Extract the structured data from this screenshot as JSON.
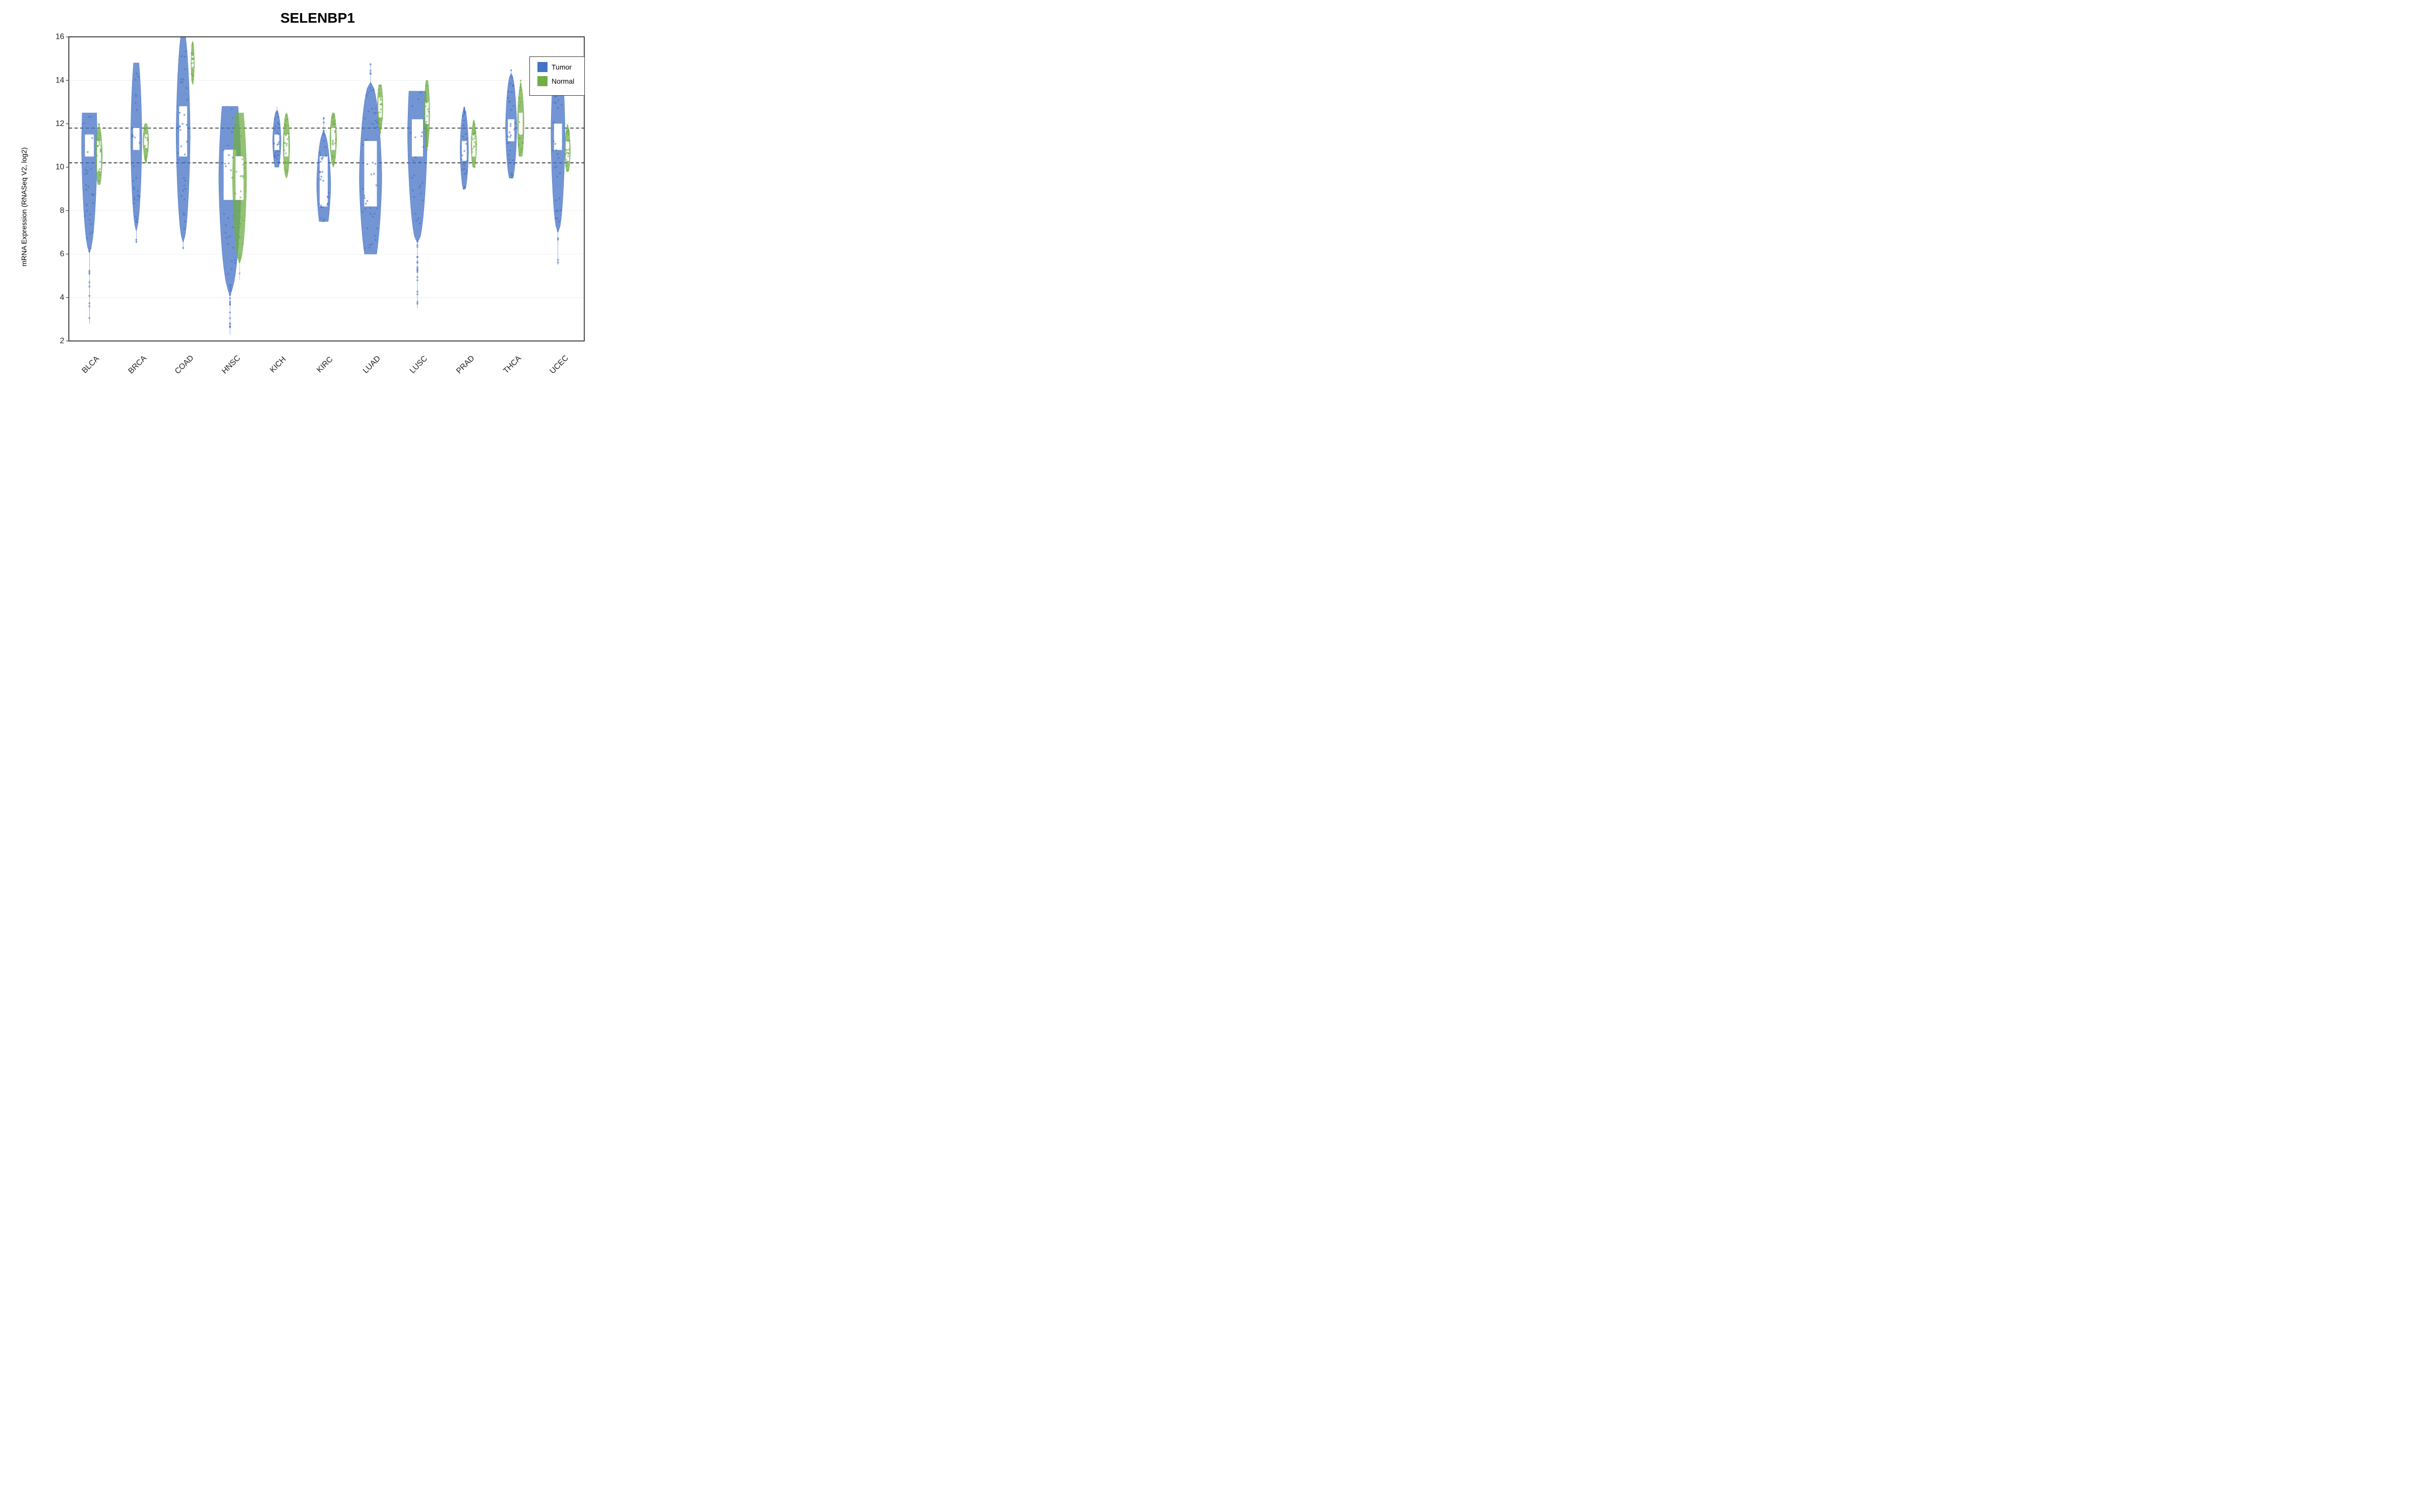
{
  "title": "SELENBP1",
  "yAxisLabel": "mRNA Expression (RNASeq V2, log2)",
  "yAxisTicks": [
    2,
    4,
    6,
    8,
    10,
    12,
    14,
    16
  ],
  "xAxisLabels": [
    "BLCA",
    "BRCA",
    "COAD",
    "HNSC",
    "KICH",
    "KIRC",
    "LUAD",
    "LUSC",
    "PRAD",
    "THCA",
    "UCEC"
  ],
  "legend": {
    "items": [
      {
        "label": "Tumor",
        "color": "#4472C4"
      },
      {
        "label": "Normal",
        "color": "#70AD47"
      }
    ]
  },
  "dotted_lines": [
    10.2,
    11.8
  ],
  "violins": [
    {
      "cancer": "BLCA",
      "tumor": {
        "center": 11.0,
        "spread": 2.8,
        "iqr_low": 10.5,
        "iqr_high": 11.5,
        "min": 2.8,
        "max": 12.5
      },
      "normal": {
        "center": 10.5,
        "spread": 1.2,
        "iqr_low": 9.8,
        "iqr_high": 11.2,
        "min": 9.2,
        "max": 12.0
      }
    },
    {
      "cancer": "BRCA",
      "tumor": {
        "center": 11.3,
        "spread": 2.0,
        "iqr_low": 10.8,
        "iqr_high": 11.8,
        "min": 6.5,
        "max": 14.8
      },
      "normal": {
        "center": 11.2,
        "spread": 1.0,
        "iqr_low": 10.9,
        "iqr_high": 11.5,
        "min": 10.2,
        "max": 12.0
      }
    },
    {
      "cancer": "COAD",
      "tumor": {
        "center": 11.5,
        "spread": 2.5,
        "iqr_low": 10.5,
        "iqr_high": 12.8,
        "min": 6.2,
        "max": 16.0
      },
      "normal": {
        "center": 14.8,
        "spread": 0.6,
        "iqr_low": 14.5,
        "iqr_high": 15.1,
        "min": 13.8,
        "max": 15.8
      }
    },
    {
      "cancer": "HNSC",
      "tumor": {
        "center": 9.5,
        "spread": 4.0,
        "iqr_low": 8.5,
        "iqr_high": 10.8,
        "min": 2.3,
        "max": 12.8
      },
      "normal": {
        "center": 9.5,
        "spread": 2.5,
        "iqr_low": 8.5,
        "iqr_high": 10.5,
        "min": 4.8,
        "max": 12.5
      }
    },
    {
      "cancer": "KICH",
      "tumor": {
        "center": 11.2,
        "spread": 1.5,
        "iqr_low": 10.8,
        "iqr_high": 11.5,
        "min": 10.0,
        "max": 12.8
      },
      "normal": {
        "center": 11.0,
        "spread": 1.2,
        "iqr_low": 10.5,
        "iqr_high": 11.5,
        "min": 9.5,
        "max": 12.5
      }
    },
    {
      "cancer": "KIRC",
      "tumor": {
        "center": 9.2,
        "spread": 2.5,
        "iqr_low": 8.2,
        "iqr_high": 10.5,
        "min": 7.5,
        "max": 12.3
      },
      "normal": {
        "center": 11.3,
        "spread": 1.2,
        "iqr_low": 10.8,
        "iqr_high": 11.8,
        "min": 10.0,
        "max": 12.5
      }
    },
    {
      "cancer": "LUAD",
      "tumor": {
        "center": 9.5,
        "spread": 4.0,
        "iqr_low": 8.2,
        "iqr_high": 11.2,
        "min": 6.0,
        "max": 14.8
      },
      "normal": {
        "center": 12.8,
        "spread": 1.0,
        "iqr_low": 12.3,
        "iqr_high": 13.2,
        "min": 11.5,
        "max": 13.8
      }
    },
    {
      "cancer": "LUSC",
      "tumor": {
        "center": 11.5,
        "spread": 3.5,
        "iqr_low": 10.5,
        "iqr_high": 12.2,
        "min": 3.5,
        "max": 13.5
      },
      "normal": {
        "center": 12.5,
        "spread": 1.0,
        "iqr_low": 12.0,
        "iqr_high": 13.0,
        "min": 10.8,
        "max": 14.0
      }
    },
    {
      "cancer": "PRAD",
      "tumor": {
        "center": 10.8,
        "spread": 1.5,
        "iqr_low": 10.3,
        "iqr_high": 11.2,
        "min": 9.0,
        "max": 12.8
      },
      "normal": {
        "center": 11.0,
        "spread": 1.0,
        "iqr_low": 10.5,
        "iqr_high": 11.5,
        "min": 10.0,
        "max": 12.2
      }
    },
    {
      "cancer": "THCA",
      "tumor": {
        "center": 11.8,
        "spread": 2.0,
        "iqr_low": 11.2,
        "iqr_high": 12.2,
        "min": 9.5,
        "max": 14.5
      },
      "normal": {
        "center": 12.0,
        "spread": 1.2,
        "iqr_low": 11.5,
        "iqr_high": 12.5,
        "min": 10.5,
        "max": 14.0
      }
    },
    {
      "cancer": "UCEC",
      "tumor": {
        "center": 11.5,
        "spread": 2.5,
        "iqr_low": 10.8,
        "iqr_high": 12.0,
        "min": 5.5,
        "max": 14.5
      },
      "normal": {
        "center": 10.8,
        "spread": 1.0,
        "iqr_low": 10.3,
        "iqr_high": 11.2,
        "min": 9.8,
        "max": 12.0
      }
    }
  ]
}
